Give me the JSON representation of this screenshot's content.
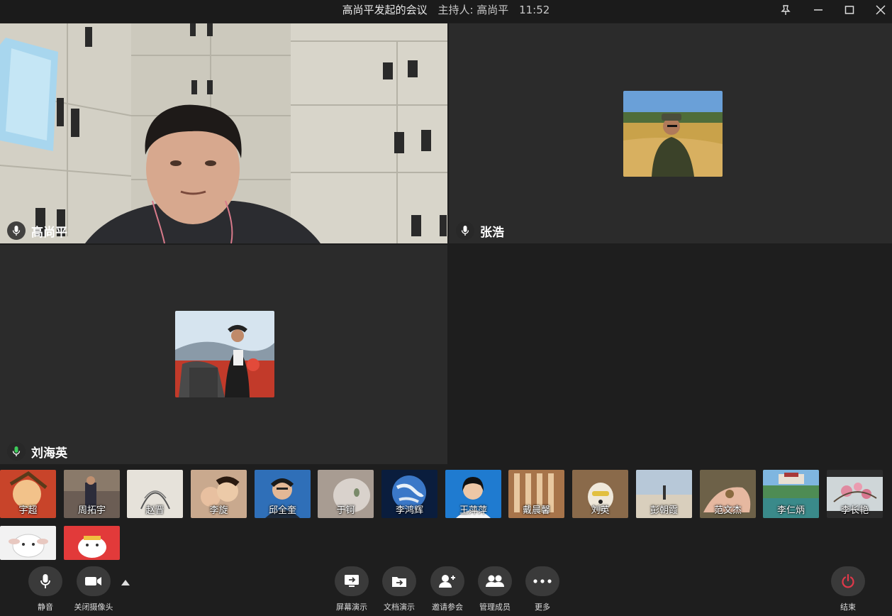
{
  "titlebar": {
    "meeting_title": "高尚平发起的会议",
    "host_label": "主持人: 高尚平",
    "time": "11:52"
  },
  "tiles": [
    {
      "name": "高尚平",
      "mic_color": "#ffffff"
    },
    {
      "name": "张浩",
      "mic_color": "#ffffff"
    },
    {
      "name": "刘海英",
      "mic_color": "#3dcc5a"
    }
  ],
  "participants": [
    {
      "name": "宇超",
      "bg": "#c8442a"
    },
    {
      "name": "周拓宇",
      "bg": "#6b5d54"
    },
    {
      "name": "赵晋",
      "bg": "#e6e2da"
    },
    {
      "name": "李旋",
      "bg": "#c9a98e"
    },
    {
      "name": "邱全奎",
      "bg": "#2f6fb8"
    },
    {
      "name": "于钶",
      "bg": "#a89c92"
    },
    {
      "name": "李鸿辉",
      "bg": "#0a1d3d"
    },
    {
      "name": "王萍萍",
      "bg": "#1f7bd0"
    },
    {
      "name": "戴晨馨",
      "bg": "#a7744a"
    },
    {
      "name": "刘英",
      "bg": "#8a6a4a"
    },
    {
      "name": "彭朝霞",
      "bg": "#8aa0b3"
    },
    {
      "name": "范文杰",
      "bg": "#6d6148"
    },
    {
      "name": "李仁炳",
      "bg": "#4e8c54"
    },
    {
      "name": "李长艳",
      "bg": "#2c2c2c"
    },
    {
      "name": "",
      "bg": "#f2f2f2"
    },
    {
      "name": "",
      "bg": "#e23a3a"
    }
  ],
  "toolbar": {
    "mute": "静音",
    "camera_off": "关闭摄像头",
    "screen_share": "屏幕演示",
    "doc_share": "文档演示",
    "invite": "邀请参会",
    "manage_members": "管理成员",
    "more": "更多",
    "end": "结束"
  },
  "colors": {
    "end_icon": "#e0394a",
    "active_mic": "#3dcc5a"
  }
}
